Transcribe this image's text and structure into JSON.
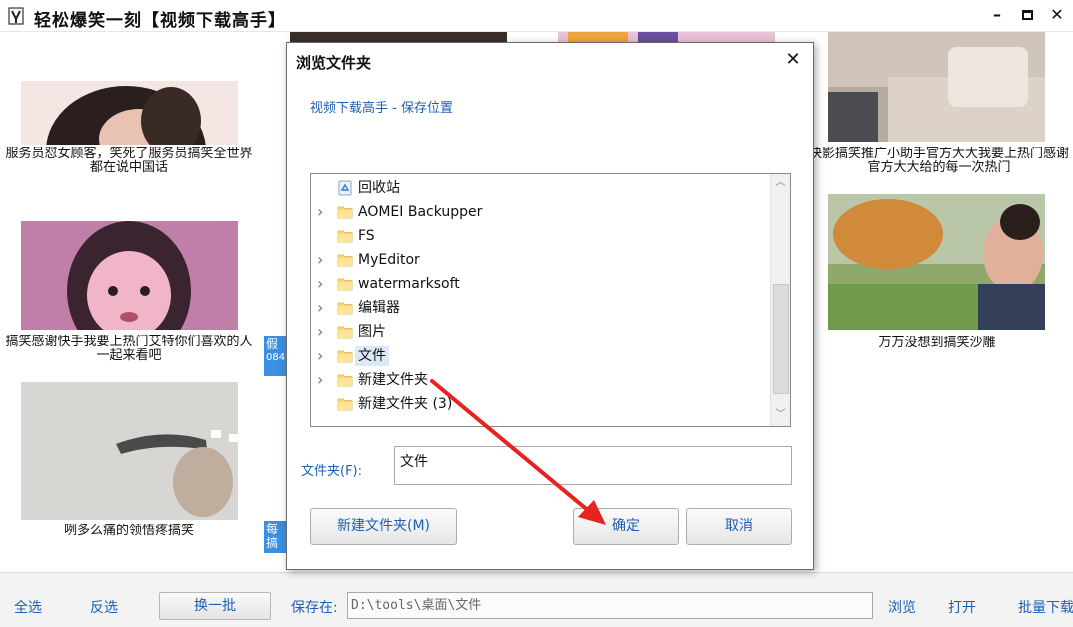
{
  "app": {
    "title": "轻松爆笑一刻【视频下载高手】",
    "minimize": "–",
    "maximize": "□",
    "close": "✕"
  },
  "videos": [
    {
      "caption": "服务员怼女顾客，笑死了服务员搞笑全世界都在说中国话"
    },
    {
      "caption": "快影搞笑推广小助手官方大大我要上热门感谢官方大大给的每一次热门"
    },
    {
      "caption": "搞笑感谢快手我要上热门艾特你们喜欢的人一起来看吧"
    },
    {
      "caption": "万万没想到搞笑沙雕"
    },
    {
      "caption": "咧多么痛的领悟疼搞笑"
    }
  ],
  "hidden_tags": {
    "tag1_top": "假",
    "tag1_bottom": "084",
    "tag2_top": "每",
    "tag2_bottom": "搞"
  },
  "bottom": {
    "select_all": "全选",
    "invert": "反选",
    "next_batch": "换一批",
    "save_label": "保存在:",
    "save_path": "D:\\tools\\桌面\\文件",
    "browse": "浏览",
    "open": "打开",
    "batch_download": "批量下载"
  },
  "dialog": {
    "title": "浏览文件夹",
    "close": "✕",
    "description": "视频下载高手 - 保存位置",
    "tree": [
      {
        "label": "回收站",
        "icon": "recycle-bin-icon",
        "expandable": false
      },
      {
        "label": "AOMEI Backupper",
        "icon": "folder-icon",
        "expandable": true
      },
      {
        "label": "FS",
        "icon": "folder-icon",
        "expandable": false
      },
      {
        "label": "MyEditor",
        "icon": "folder-icon",
        "expandable": true
      },
      {
        "label": "watermarksoft",
        "icon": "folder-icon",
        "expandable": true
      },
      {
        "label": "编辑器",
        "icon": "folder-icon",
        "expandable": true
      },
      {
        "label": "图片",
        "icon": "folder-icon",
        "expandable": true
      },
      {
        "label": "文件",
        "icon": "folder-icon",
        "expandable": true,
        "selected": true
      },
      {
        "label": "新建文件夹",
        "icon": "folder-icon",
        "expandable": true
      },
      {
        "label": "新建文件夹 (3)",
        "icon": "folder-icon",
        "expandable": false
      }
    ],
    "folder_label": "文件夹(F):",
    "folder_value": "文件",
    "new_folder": "新建文件夹(M)",
    "ok": "确定",
    "cancel": "取消"
  },
  "colors": {
    "link": "#1f5fb3",
    "selection": "#dbe8f7",
    "arrow": "#e8231f"
  }
}
